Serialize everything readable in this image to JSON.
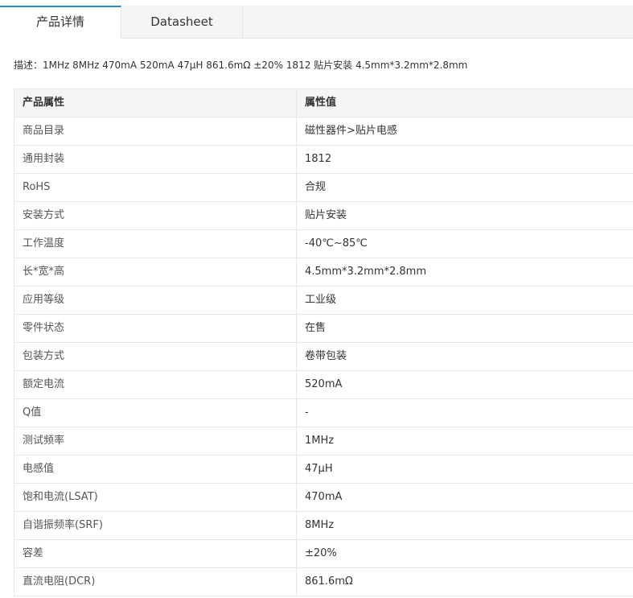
{
  "tabs": [
    {
      "label": "产品详情",
      "active": true
    },
    {
      "label": "Datasheet",
      "active": false
    }
  ],
  "description": "描述：1MHz 8MHz 470mA 520mA 47μH 861.6mΩ ±20% 1812 贴片安装 4.5mm*3.2mm*2.8mm",
  "table": {
    "headers": [
      "产品属性",
      "属性值"
    ],
    "rows": [
      [
        "商品目录",
        "磁性器件>贴片电感"
      ],
      [
        "通用封装",
        "1812"
      ],
      [
        "RoHS",
        "合规"
      ],
      [
        "安装方式",
        "贴片安装"
      ],
      [
        "工作温度",
        "-40℃~85℃"
      ],
      [
        "长*宽*高",
        "4.5mm*3.2mm*2.8mm"
      ],
      [
        "应用等级",
        "工业级"
      ],
      [
        "零件状态",
        "在售"
      ],
      [
        "包装方式",
        "卷带包装"
      ],
      [
        "额定电流",
        "520mA"
      ],
      [
        "Q值",
        "-"
      ],
      [
        "测试频率",
        "1MHz"
      ],
      [
        "电感值",
        "47μH"
      ],
      [
        "饱和电流(LSAT)",
        "470mA"
      ],
      [
        "自谐振频率(SRF)",
        "8MHz"
      ],
      [
        "容差",
        "±20%"
      ],
      [
        "直流电阻(DCR)",
        "861.6mΩ"
      ]
    ]
  },
  "colors": {
    "active_tab_accent": "#2a8ad4",
    "tabbar_bg": "#f5f5f5",
    "header_bg": "#f5f5f5",
    "border": "#e8e8e8"
  }
}
